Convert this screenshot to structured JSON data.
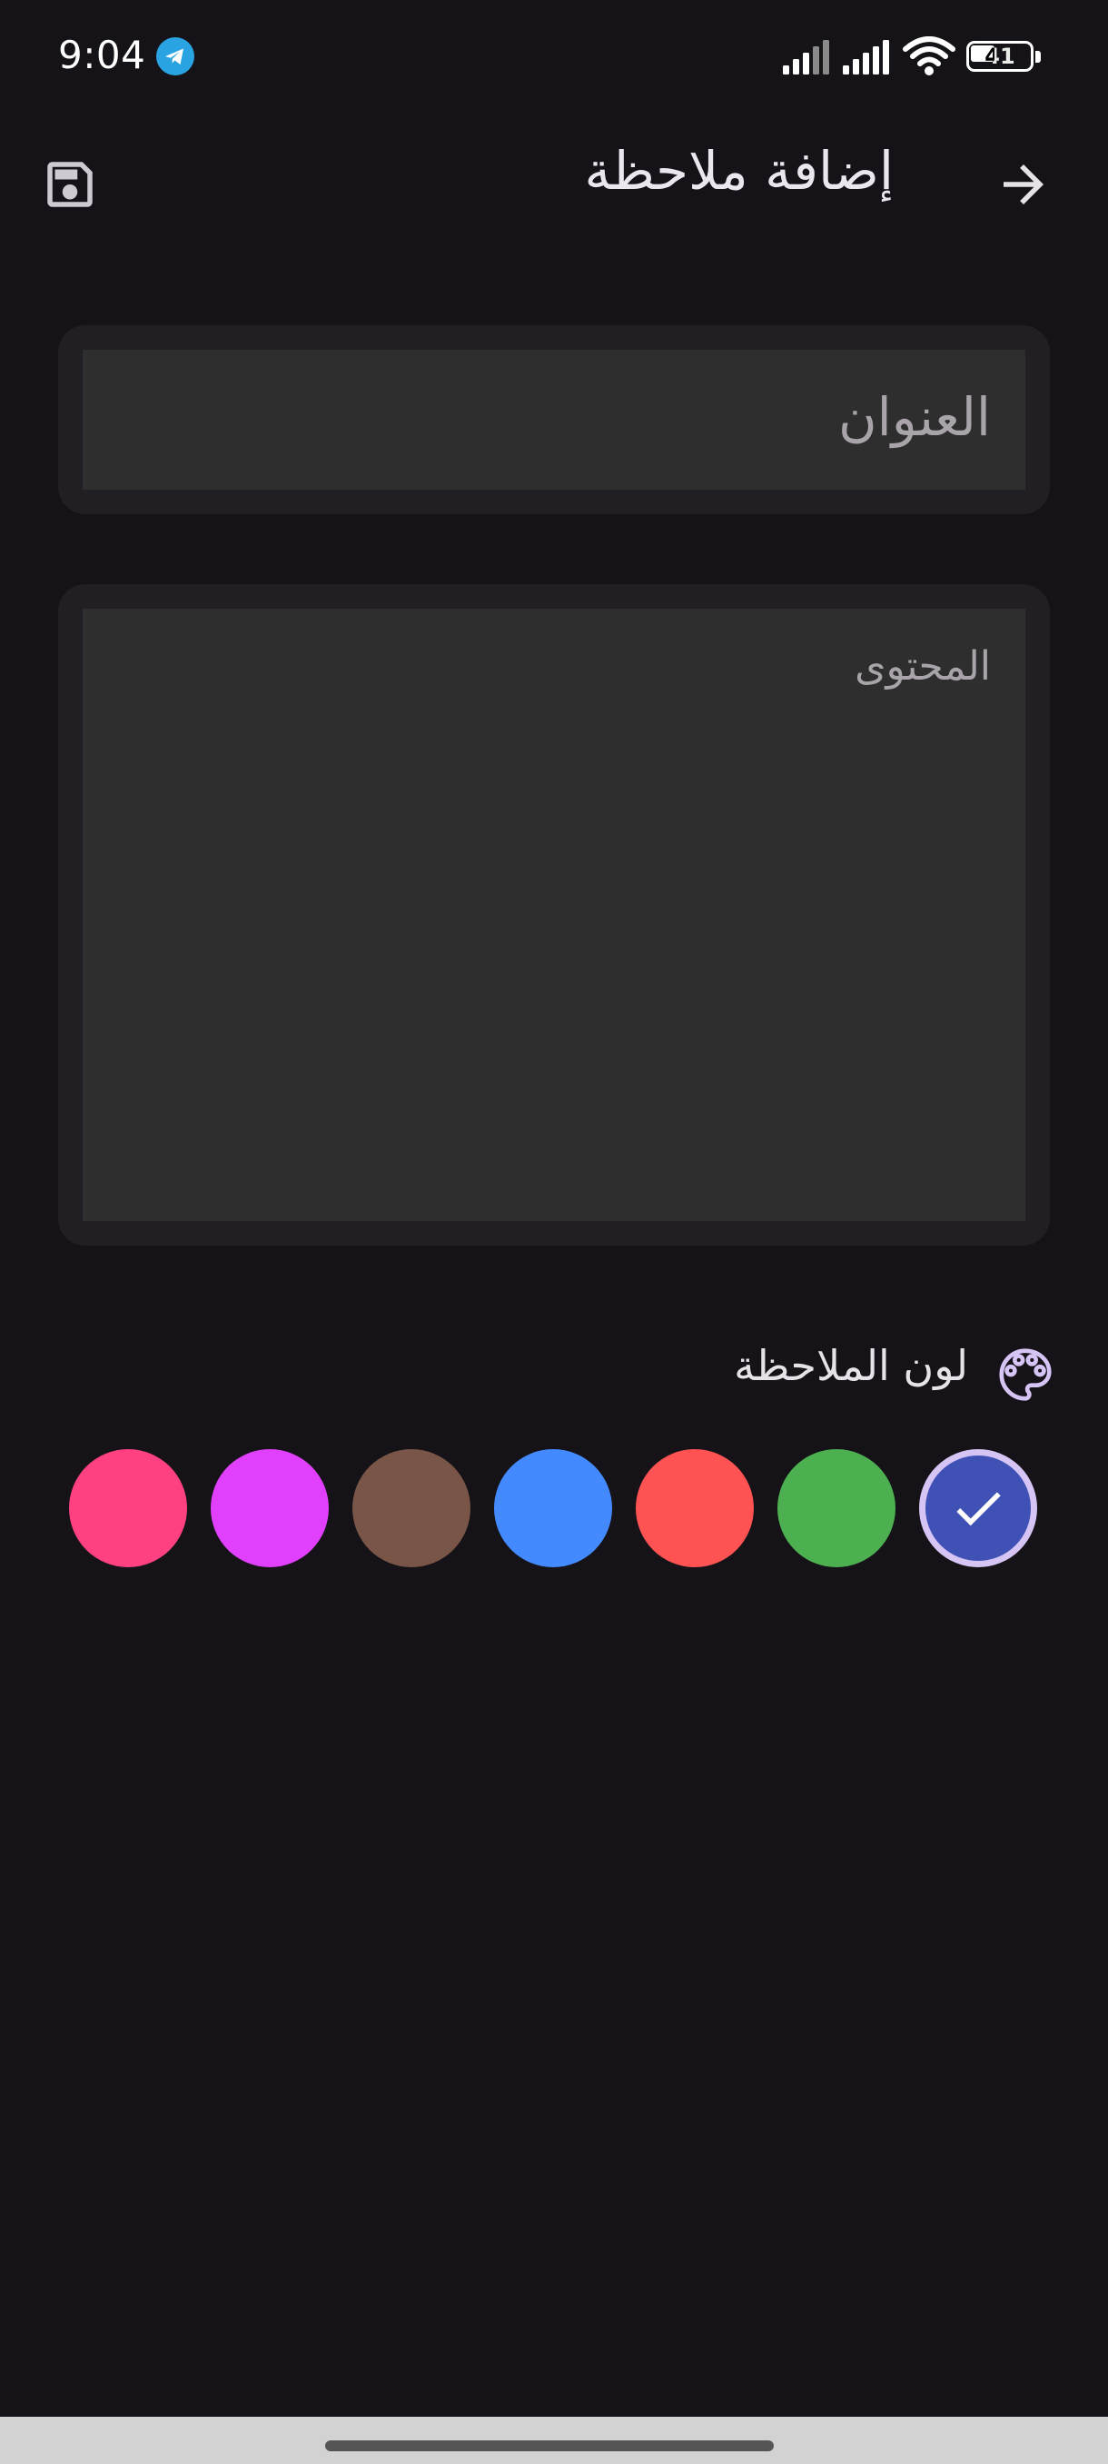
{
  "status_bar": {
    "time": "9:04",
    "battery_level": "41",
    "icons": [
      "telegram-icon",
      "signal-icon",
      "signal-icon",
      "wifi-icon",
      "battery-icon"
    ]
  },
  "app_bar": {
    "title": "إضافة ملاحظة",
    "save_icon": "save-icon",
    "back_icon": "arrow-right-icon"
  },
  "form": {
    "title_placeholder": "العنوان",
    "content_placeholder": "المحتوى"
  },
  "color_picker": {
    "label": "لون الملاحظة",
    "icon": "palette-icon",
    "selected_index": 6,
    "swatches": [
      {
        "name": "pink",
        "color": "#FF4081"
      },
      {
        "name": "purple",
        "color": "#E040FB"
      },
      {
        "name": "brown",
        "color": "#795548"
      },
      {
        "name": "blue",
        "color": "#448AFF"
      },
      {
        "name": "red",
        "color": "#FF5252"
      },
      {
        "name": "green",
        "color": "#4CAF50"
      },
      {
        "name": "indigo",
        "color": "#3F51B5"
      }
    ]
  },
  "colors": {
    "background": "#151317",
    "card": "#211F24",
    "field": "#2E2E2E",
    "accent": "#D6C4F5"
  }
}
